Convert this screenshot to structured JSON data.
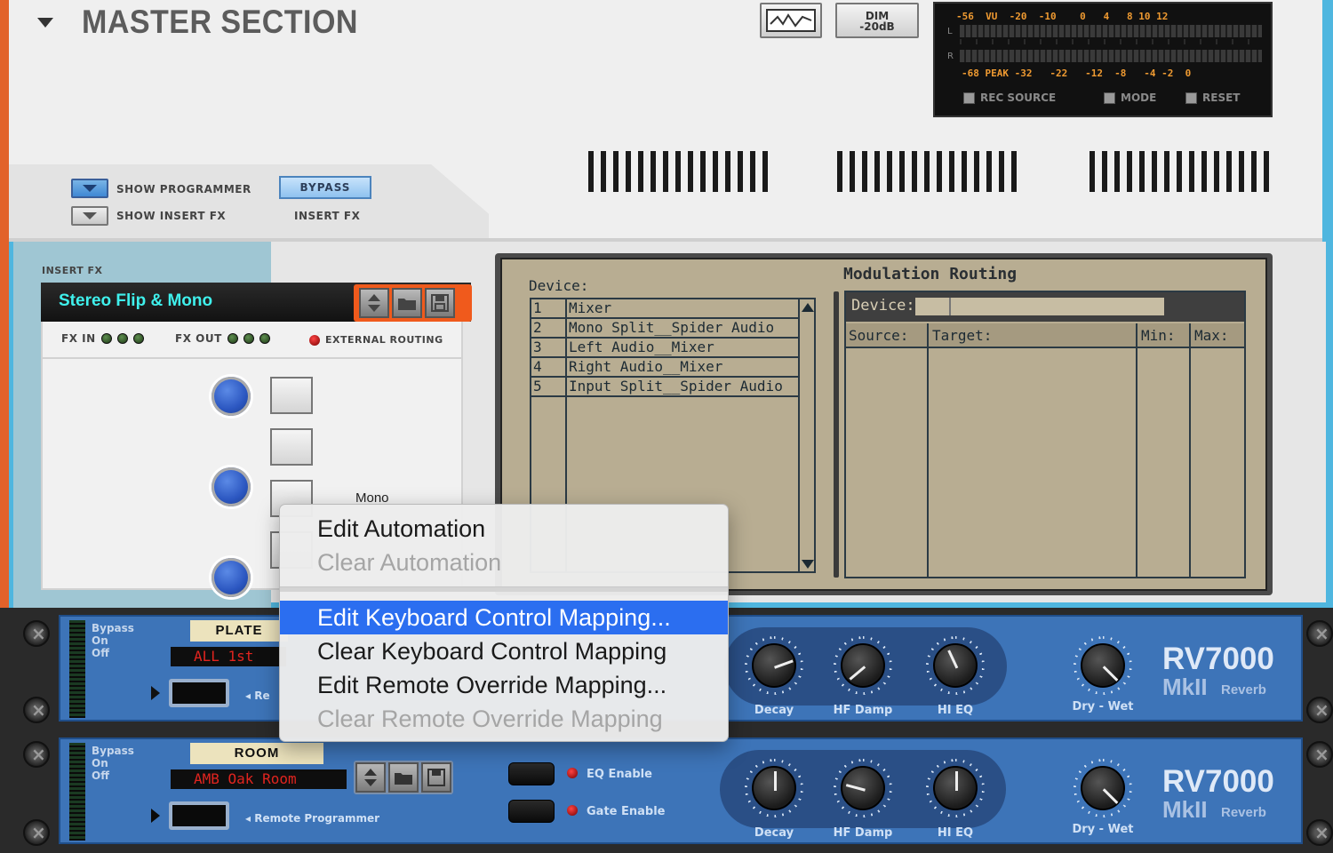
{
  "master": {
    "title": "MASTER SECTION",
    "dim_label_1": "DIM",
    "dim_label_2": "-20dB",
    "meter": {
      "top_scale": "-56  VU  -20  -10    0   4   8 10 12",
      "bottom_scale": "-68 PEAK -32   -22   -12  -8   -4 -2  0",
      "left_label": "L",
      "right_label": "R",
      "checkboxes": [
        "REC SOURCE",
        "MODE",
        "RESET"
      ]
    },
    "show_programmer": "SHOW PROGRAMMER",
    "show_insert_fx": "SHOW INSERT FX",
    "bypass": "BYPASS",
    "insert_fx_caption": "INSERT FX"
  },
  "insert": {
    "header": "INSERT FX",
    "patch_name": "Stereo Flip & Mono",
    "fx_in": "FX IN",
    "fx_out": "FX OUT",
    "external_routing": "EXTERNAL ROUTING",
    "knob_label": "Mono"
  },
  "modulation": {
    "device_header": "Device:",
    "devices": [
      {
        "num": "1",
        "name": "Mixer"
      },
      {
        "num": "2",
        "name": "Mono Split__Spider Audio"
      },
      {
        "num": "3",
        "name": "Left Audio__Mixer"
      },
      {
        "num": "4",
        "name": "Right Audio__Mixer"
      },
      {
        "num": "5",
        "name": "Input Split__Spider Audio"
      }
    ],
    "title": "Modulation Routing",
    "device_field": "Device:",
    "columns": [
      "Source:",
      "Target:",
      "Min:",
      "Max:"
    ]
  },
  "devices": [
    {
      "label": "PLATE",
      "patch": "ALL 1st",
      "bypass": "Bypass",
      "on": "On",
      "off": "Off",
      "remote": "◂ Re",
      "knobs": [
        "Decay",
        "HF Damp",
        "HI EQ"
      ],
      "drywet": "Dry - Wet",
      "logo": "RV7000",
      "logo_sub": "MkII",
      "logo_reverb": "Reverb"
    },
    {
      "label": "ROOM",
      "patch": "AMB Oak Room",
      "bypass": "Bypass",
      "on": "On",
      "off": "Off",
      "remote": "◂ Remote Programmer",
      "eq_enable": "EQ Enable",
      "gate_enable": "Gate Enable",
      "knobs": [
        "Decay",
        "HF Damp",
        "HI EQ"
      ],
      "drywet": "Dry - Wet",
      "logo": "RV7000",
      "logo_sub": "MkII",
      "logo_reverb": "Reverb"
    }
  ],
  "context_menu": {
    "items": [
      {
        "label": "Edit Automation",
        "state": "enabled"
      },
      {
        "label": "Clear Automation",
        "state": "disabled"
      },
      {
        "label": "Edit Keyboard Control Mapping...",
        "state": "selected"
      },
      {
        "label": "Clear Keyboard Control Mapping",
        "state": "enabled"
      },
      {
        "label": "Edit Remote Override Mapping...",
        "state": "enabled"
      },
      {
        "label": "Clear Remote Override Mapping",
        "state": "disabled"
      }
    ]
  },
  "colors": {
    "accent_orange": "#f05a1c",
    "selection_blue": "#2b6ef0",
    "rack_blue": "#3d74b8",
    "lcd_cyan": "#3ff0ec",
    "meter_amber": "#ef9a31"
  }
}
